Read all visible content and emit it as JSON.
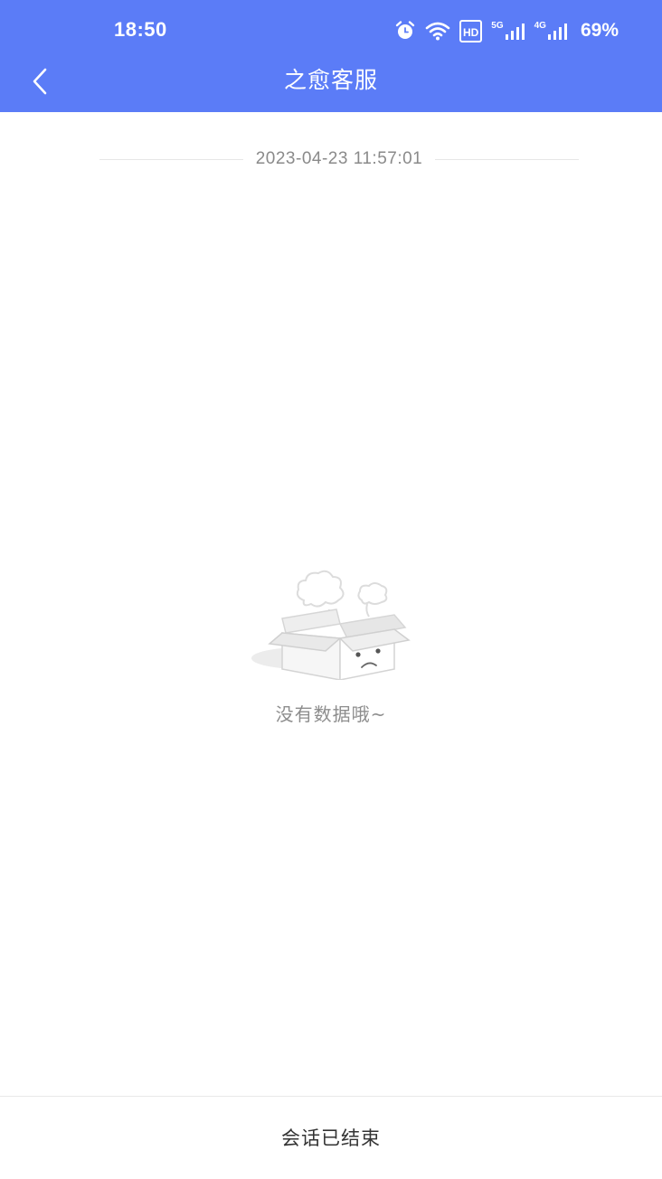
{
  "status_bar": {
    "time": "18:50",
    "signal_5g_label": "5G",
    "signal_4g_label": "4G",
    "hd_label": "HD",
    "battery": "69%",
    "icons": [
      "alarm-icon",
      "wifi-icon",
      "hd-voice-icon",
      "signal-5g-icon",
      "signal-4g-icon"
    ]
  },
  "nav": {
    "title": "之愈客服",
    "back_icon": "chevron-left-icon"
  },
  "chat": {
    "timestamp": "2023-04-23 11:57:01",
    "empty_text": "没有数据哦~",
    "empty_icon": "empty-box-icon"
  },
  "footer": {
    "status_text": "会话已结束"
  },
  "colors": {
    "header_bg": "#5b7cf7",
    "header_text": "#ffffff",
    "muted_text": "#8a8a8a",
    "footer_text": "#333333"
  }
}
